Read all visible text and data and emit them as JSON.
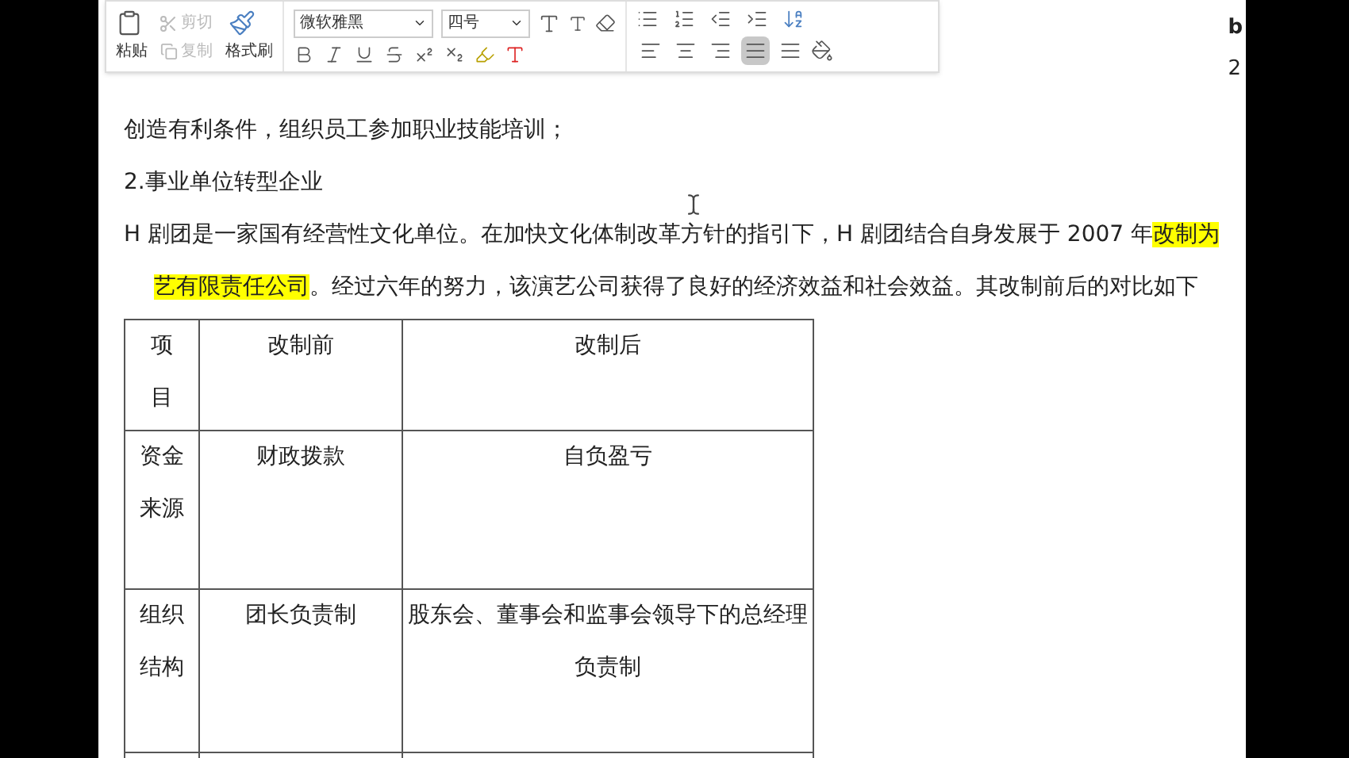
{
  "toolbar": {
    "paste": "粘贴",
    "cut": {
      "label": "剪切",
      "disabled": true
    },
    "copy": {
      "label": "复制",
      "disabled": true
    },
    "format_painter": "格式刷",
    "font_family": "微软雅黑",
    "font_size": "四号",
    "align_buttons": [
      {
        "kind": "left",
        "selected": false
      },
      {
        "kind": "center",
        "selected": false
      },
      {
        "kind": "right",
        "selected": false
      },
      {
        "kind": "justify",
        "selected": true
      },
      {
        "kind": "distributed",
        "selected": false
      }
    ]
  },
  "side_text": [
    "b",
    "2"
  ],
  "document": {
    "paragraphs": [
      {
        "kind": "plain",
        "segments": [
          {
            "text": "创造有利条件，组织员工参加职业技能培训；",
            "highlight": false
          }
        ]
      },
      {
        "kind": "plain",
        "segments": [
          {
            "text": "2.事业单位转型企业",
            "highlight": false
          }
        ]
      },
      {
        "kind": "plain",
        "segments": [
          {
            "text": "H 剧团是一家国有经营性文化单位。在加快文化体制改革方针的指引下，H 剧团结合自身发展于 2007 年",
            "highlight": false
          },
          {
            "text": "改制为",
            "highlight": true
          }
        ]
      },
      {
        "kind": "indented",
        "segments": [
          {
            "text": "艺有限责任公司",
            "highlight": true
          },
          {
            "text": "。经过六年的努力，该演艺公司获得了良好的经济效益和社会效益。其改制前后的对比如下",
            "highlight": false
          }
        ]
      }
    ],
    "table": {
      "columns": [
        "项目",
        "改制前",
        "改制后"
      ],
      "rows": [
        [
          "资金来源",
          "财政拨款",
          "自负盈亏"
        ],
        [
          "组织结构",
          "团长负责制",
          "股东会、董事会和监事会领导下的总经理负责制"
        ]
      ]
    }
  }
}
